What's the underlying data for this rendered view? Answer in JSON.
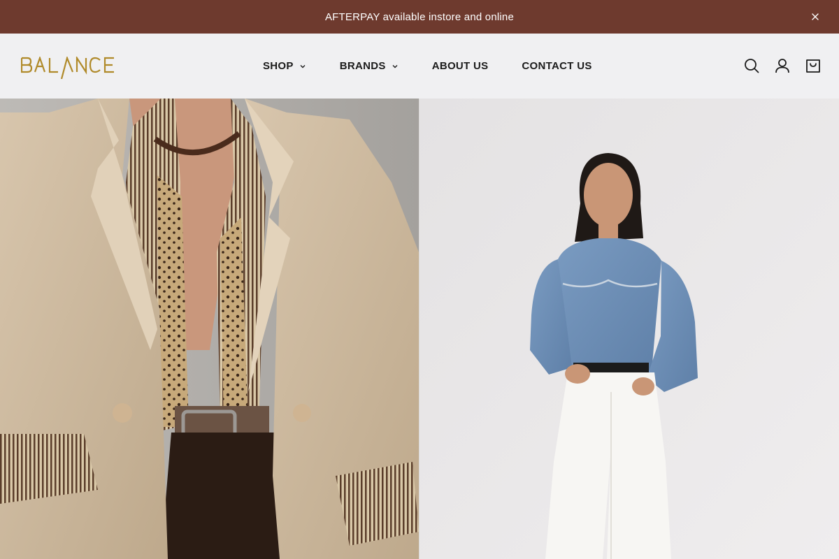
{
  "announcement": {
    "text": "AFTERPAY available instore and online",
    "close_icon": "close-icon"
  },
  "header": {
    "logo_text": "BALANCE",
    "nav": [
      {
        "label": "SHOP",
        "has_dropdown": true
      },
      {
        "label": "BRANDS",
        "has_dropdown": true
      },
      {
        "label": "ABOUT US",
        "has_dropdown": false
      },
      {
        "label": "CONTACT US",
        "has_dropdown": false
      }
    ],
    "icons": [
      "search-icon",
      "account-icon",
      "cart-icon"
    ]
  },
  "colors": {
    "announcement_bg": "#6e3a2e",
    "header_bg": "#f0f0f2",
    "logo": "#b08a2a",
    "nav_text": "#1b1b1b"
  },
  "hero": {
    "left_image": "model-in-camel-coat-and-striped-shirt",
    "right_image": "model-in-denim-western-shirt-and-white-jeans"
  }
}
